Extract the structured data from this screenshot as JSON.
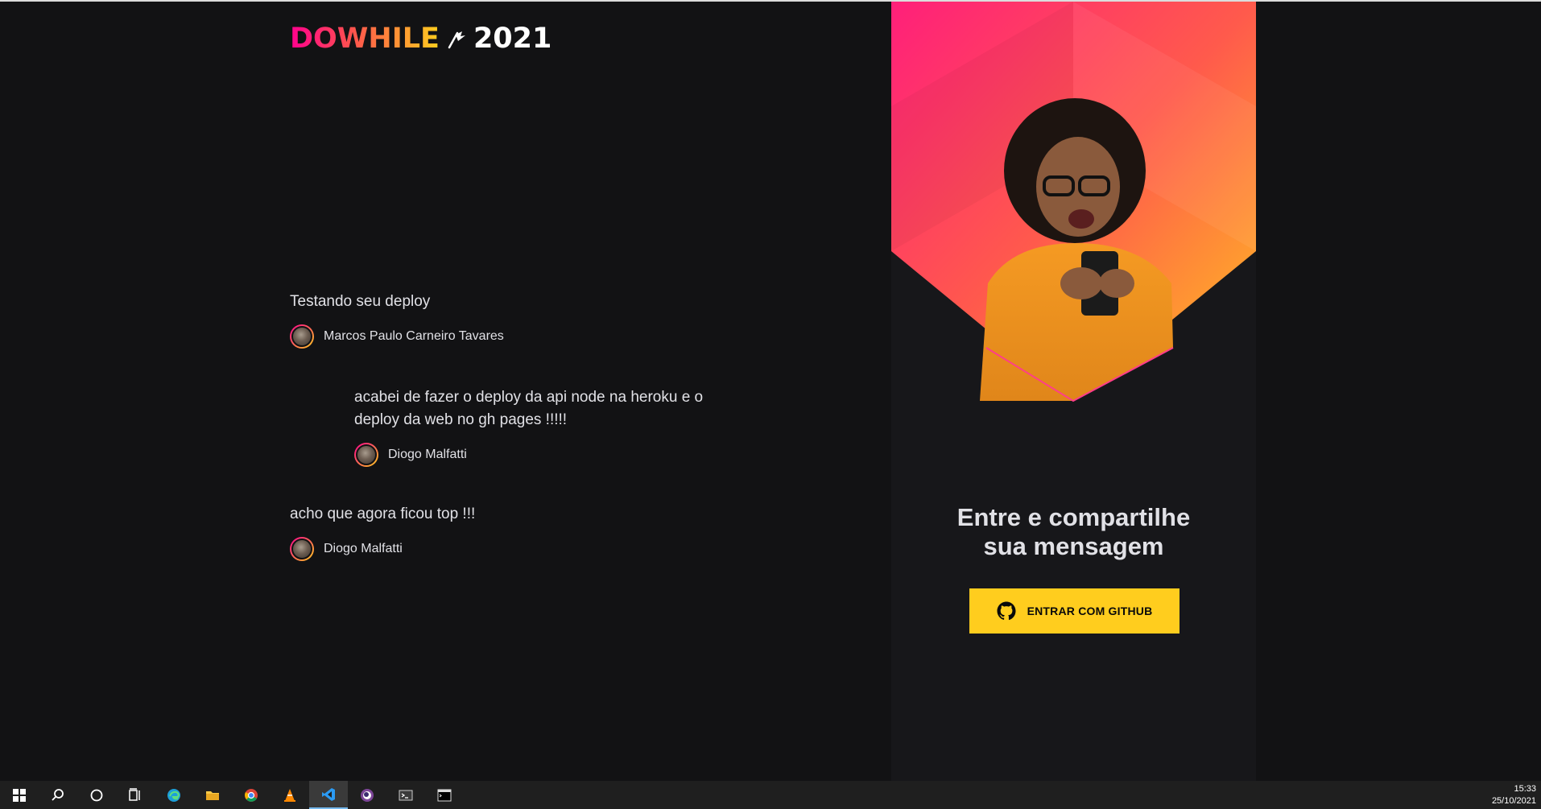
{
  "logo": {
    "word": "DOWHILE",
    "year": "2021"
  },
  "messages": [
    {
      "content": "Testando seu deploy",
      "user": "Marcos Paulo Carneiro Tavares"
    },
    {
      "content": "acabei de fazer o deploy da api node na heroku e o deploy da web no gh pages !!!!!",
      "user": "Diogo Malfatti"
    },
    {
      "content": "acho que agora ficou top !!!",
      "user": "Diogo Malfatti"
    }
  ],
  "panel": {
    "title_line1": "Entre e compartilhe",
    "title_line2": "sua mensagem",
    "button_label": "ENTRAR COM GITHUB"
  },
  "taskbar": {
    "time": "15:33",
    "date": "25/10/2021",
    "icons": [
      "windows-start-icon",
      "search-icon",
      "cortana-icon",
      "task-view-icon",
      "edge-icon",
      "file-explorer-icon",
      "chrome-icon",
      "vlc-icon",
      "vscode-icon",
      "tor-icon",
      "terminal-icon",
      "cmd-icon"
    ]
  },
  "colors": {
    "background": "#121214",
    "panel": "#17171a",
    "accent_yellow": "#ffcd1e",
    "accent_pink": "#ff008e",
    "text": "#e1e1e6"
  }
}
